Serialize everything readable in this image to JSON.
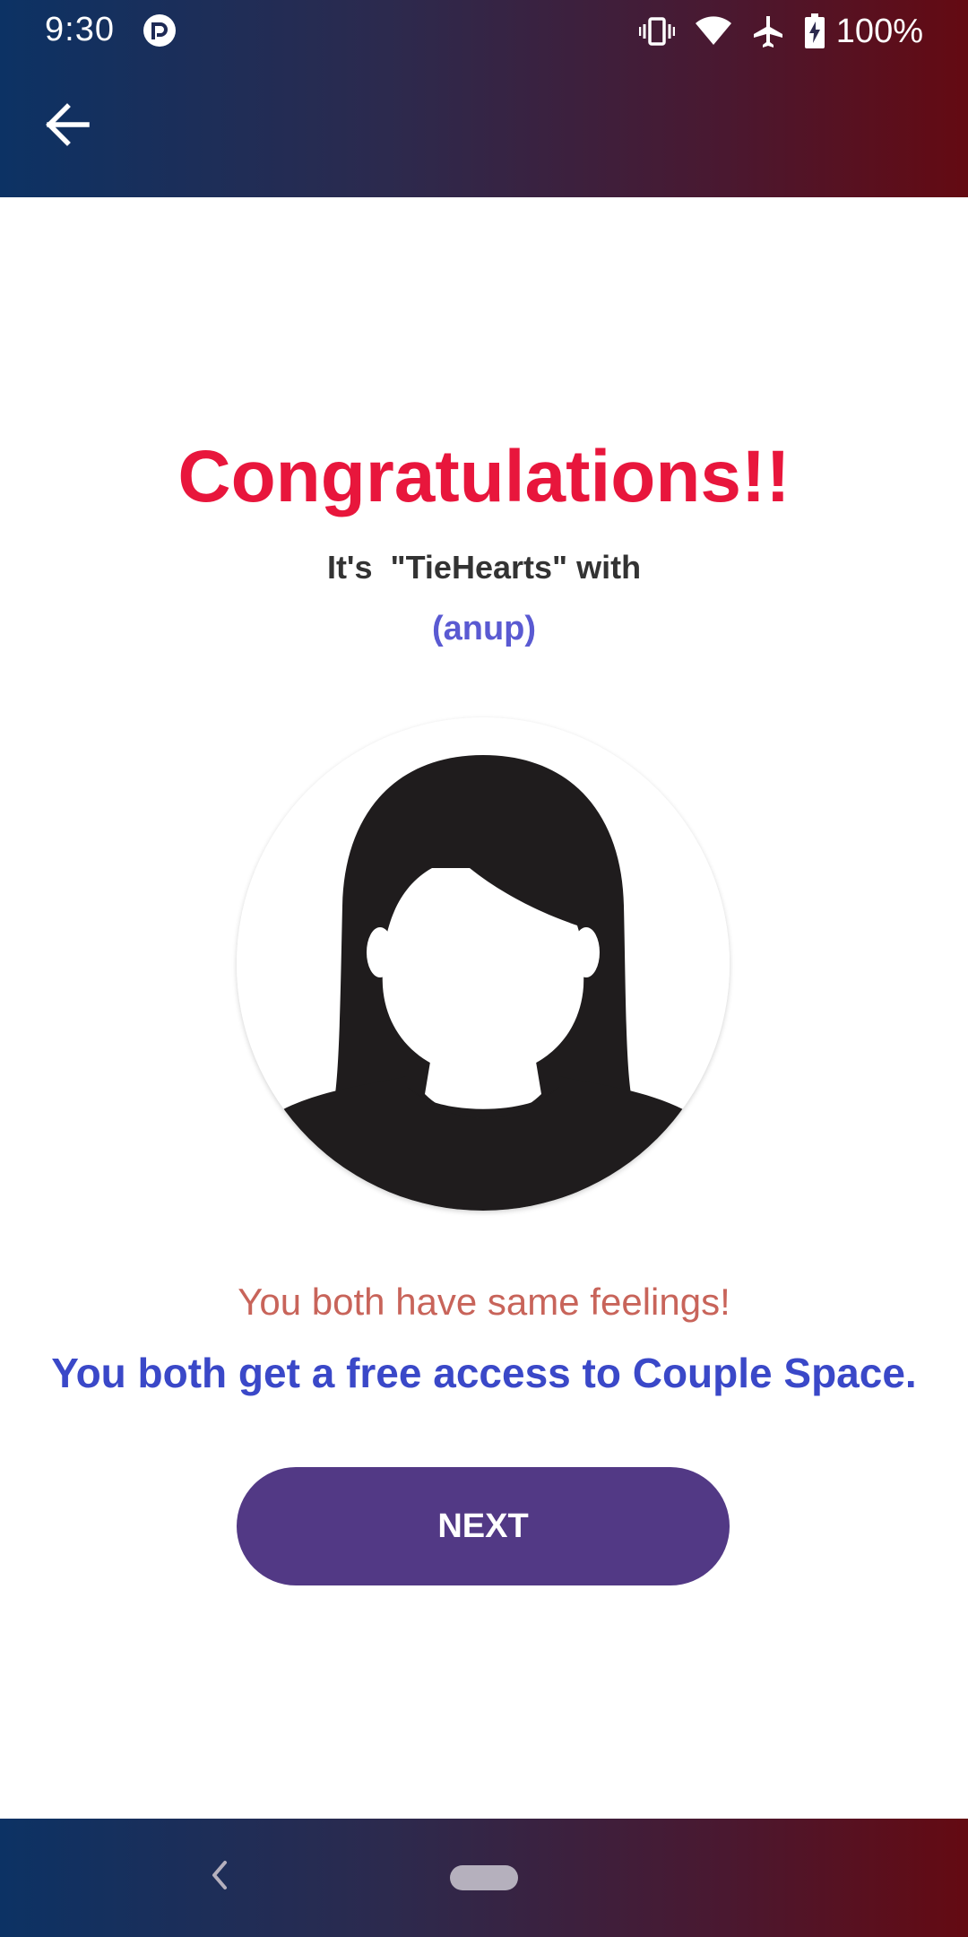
{
  "status_bar": {
    "time": "9:30",
    "battery_percent": "100%",
    "icons": [
      "app-notification-icon",
      "vibrate-icon",
      "wifi-icon",
      "airplane-mode-icon",
      "battery-charging-icon"
    ]
  },
  "header": {
    "back_icon": "arrow-left-icon",
    "background_gradient": [
      "#0c3264",
      "#640a12"
    ]
  },
  "main": {
    "title": "Congratulations!!",
    "subtitle": "It's  \"TieHearts\" with",
    "partner_name": "(anup)",
    "avatar_icon": "female-silhouette-avatar-icon",
    "feelings_text": "You both have same feelings!",
    "access_text": "You both get a free access to Couple Space.",
    "next_label": "NEXT"
  },
  "colors": {
    "title": "#e8163c",
    "partner_name": "#5a5ad2",
    "feelings_text": "#c8645a",
    "access_text": "#3a48c8",
    "button": "#523985"
  },
  "nav_bar": {
    "icons": [
      "nav-back-icon",
      "nav-home-pill-icon"
    ]
  }
}
